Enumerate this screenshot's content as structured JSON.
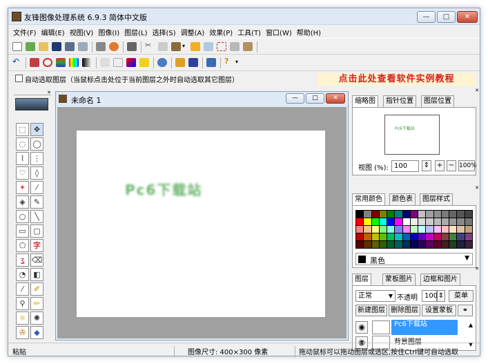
{
  "window": {
    "title": "友锋图像处理系统 6.9.3 简体中文版"
  },
  "window_controls": {
    "minimize": "—",
    "maximize": "□",
    "close": "✕"
  },
  "menu": [
    "文件(F)",
    "编辑(E)",
    "视图(V)",
    "图像(I)",
    "图层(L)",
    "选择(S)",
    "调整(A)",
    "效果(P)",
    "工具(T)",
    "窗口(W)",
    "帮助(H)"
  ],
  "options": {
    "auto_select_label": "自动选取图层（当鼠标点击处位于当前图层之外时自动选取其它图层）",
    "banner": "点击此处查看软件实例教程"
  },
  "document": {
    "name": "未命名 1",
    "watermark": "Pc6下载站"
  },
  "navigator": {
    "tabs": [
      "缩略图",
      "指针位置",
      "图层位置"
    ],
    "zoom_label": "视图 (%):",
    "zoom_value": "100",
    "zoom_in": "+",
    "zoom_out": "−",
    "zoom_reset": "100%",
    "thumb_text": "Pc6下载站"
  },
  "colors_panel": {
    "tabs": [
      "常用颜色",
      "颜色表",
      "图层样式"
    ],
    "selected_color": "黑色",
    "palette": [
      "#000000",
      "#808080",
      "#800000",
      "#808000",
      "#008000",
      "#008080",
      "#000080",
      "#800080",
      "#c0c0c0",
      "#a0a0a0",
      "#909090",
      "#7a7a7a",
      "#666666",
      "#555555",
      "#444444",
      "#ff0000",
      "#ffff00",
      "#00ff00",
      "#00ffff",
      "#0000ff",
      "#ff00ff",
      "#ffffff",
      "#eeeeee",
      "#dddddd",
      "#cccccc",
      "#bbbbbb",
      "#aaaaaa",
      "#999999",
      "#888888",
      "#777777",
      "#ff8080",
      "#ffc080",
      "#ffff80",
      "#80ff80",
      "#80ffff",
      "#8080ff",
      "#ff80ff",
      "#c0ffc0",
      "#c0ffff",
      "#c0c0ff",
      "#ffc0ff",
      "#ffc0c0",
      "#ffe0c0",
      "#e0c0a0",
      "#c0a080",
      "#c00000",
      "#c06000",
      "#c0c000",
      "#60c000",
      "#00c060",
      "#00c0c0",
      "#0060c0",
      "#0000c0",
      "#6000c0",
      "#c000c0",
      "#c00060",
      "#804040",
      "#408040",
      "#404080",
      "#804080",
      "#600000",
      "#603000",
      "#606000",
      "#306000",
      "#006030",
      "#006060",
      "#003060",
      "#000060",
      "#300060",
      "#600060",
      "#600030",
      "#402020",
      "#204020",
      "#202040",
      "#402040"
    ]
  },
  "layers_panel": {
    "tabs": [
      "图层",
      "蒙板图片",
      "边框和图片"
    ],
    "blend_mode": "正常",
    "opacity_label": "不透明",
    "opacity_value": "100",
    "menu_btn": "菜单",
    "new_layer": "新建图层",
    "delete_layer": "删除图层",
    "set_mask": "设置蒙板",
    "layers": [
      {
        "name": "Pc6下载站"
      },
      {
        "name": "背景图层"
      }
    ]
  },
  "status": {
    "left": "粘贴",
    "size": "图像尺寸: 400×300 像素",
    "hint": "拖动鼠标可以拖动图层或选区,按住Ctrl键可自动选取"
  },
  "accent": {
    "banner_red": "#d42020",
    "selection_blue": "#3399ff",
    "watermark_green": "#3a9a3a"
  }
}
